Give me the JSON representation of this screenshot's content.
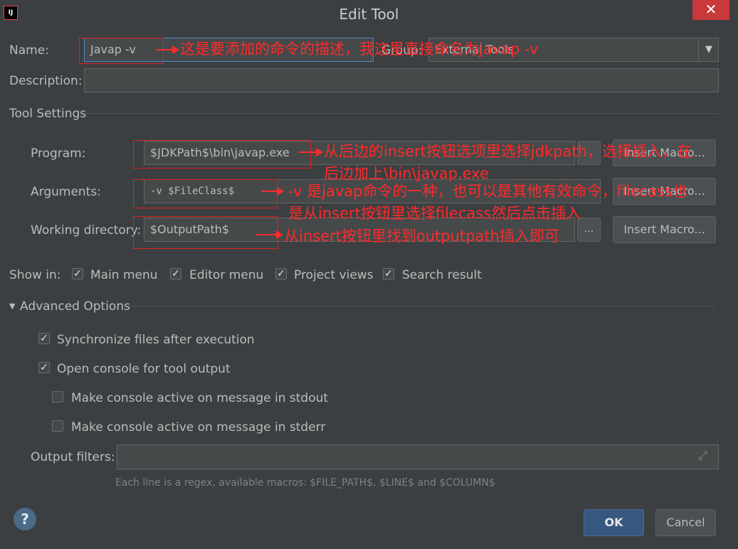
{
  "window": {
    "title": "Edit Tool",
    "close_glyph": "✕",
    "app_icon_text": "IJ"
  },
  "name": {
    "label": "Name:",
    "value": "Javap -v"
  },
  "group": {
    "label": "Group:",
    "value": "External Tools"
  },
  "description": {
    "label": "Description:",
    "value": ""
  },
  "tool_settings": {
    "heading": "Tool Settings",
    "program": {
      "label": "Program:",
      "value": "$JDKPath$\\bin\\javap.exe",
      "macro_button": "Insert Macro..."
    },
    "arguments": {
      "label": "Arguments:",
      "value": "-v $FileClass$",
      "macro_button": "Insert Macro..."
    },
    "working_directory": {
      "label": "Working directory:",
      "value": "$OutputPath$",
      "macro_button": "Insert Macro...",
      "browse_button": "..."
    }
  },
  "show_in": {
    "label": "Show in:",
    "options": [
      {
        "label": "Main menu",
        "checked": true
      },
      {
        "label": "Editor menu",
        "checked": true
      },
      {
        "label": "Project views",
        "checked": true
      },
      {
        "label": "Search result",
        "checked": true
      }
    ]
  },
  "advanced": {
    "heading": "Advanced Options",
    "options": [
      {
        "label": "Synchronize files after execution",
        "checked": true
      },
      {
        "label": "Open console for tool output",
        "checked": true
      },
      {
        "label": "Make console active on message in stdout",
        "checked": false
      },
      {
        "label": "Make console active on message in stderr",
        "checked": false
      }
    ],
    "output_filters": {
      "label": "Output filters:",
      "value": ""
    },
    "hint": "Each line is a regex, available macros: $FILE_PATH$, $LINE$ and $COLUMN$"
  },
  "footer": {
    "help": "?",
    "ok": "OK",
    "cancel": "Cancel"
  },
  "annotations": {
    "name_note": "这是要添加的命令的描述，我这里直接命名为javap -v",
    "program_note_1": "从后边的insert按钮选项里选择jdkpath，选择插入，在",
    "program_note_2": "后边加上\\bin\\javap.exe",
    "args_note_1": "-v 是javap命令的一种，也可以是其他有效命令，filecass也",
    "args_note_2": "是从insert按钮里选择filecass然后点击插入",
    "workdir_note": "从insert按钮里找到outputpath插入即可"
  },
  "colors": {
    "background": "#3c3f41",
    "annotation": "#ff2a2a",
    "ok_button": "#365880",
    "close_button": "#c9383a"
  }
}
